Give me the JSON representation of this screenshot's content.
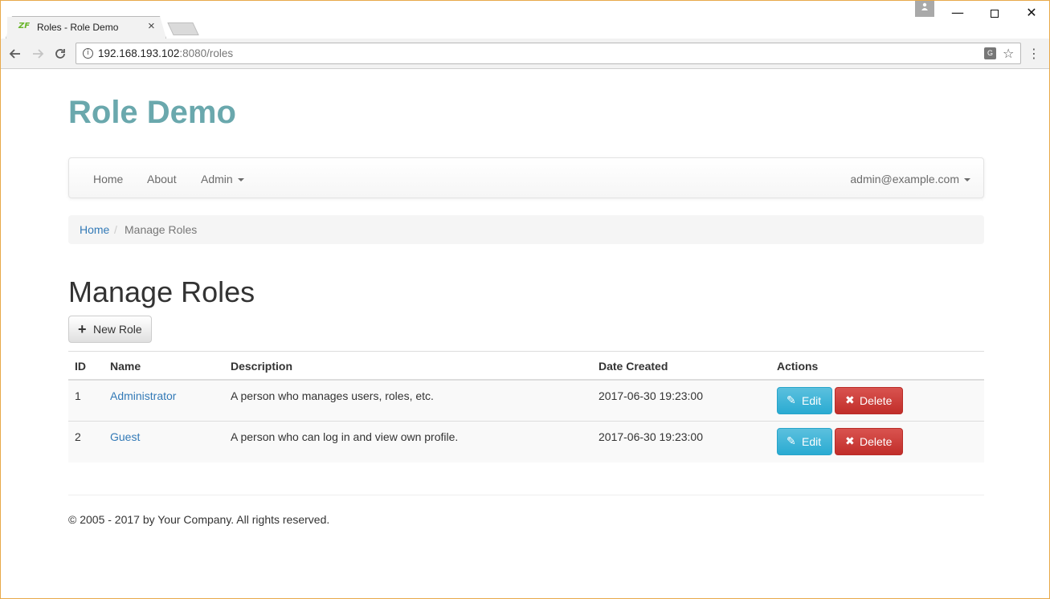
{
  "browser": {
    "tab_title": "Roles - Role Demo",
    "tab_favicon": "ZF",
    "tab_close": "×",
    "url_host": "192.168.193.102",
    "url_rest": ":8080/roles",
    "win_min": "—",
    "win_close": "✕",
    "icons": {
      "back": "arrow-left-icon",
      "forward": "arrow-right-icon",
      "reload": "reload-icon",
      "info": "info-icon",
      "translate": "translate-icon",
      "star": "star-icon",
      "menu": "kebab-menu-icon",
      "profile": "person-icon"
    }
  },
  "site": {
    "title": "Role Demo",
    "title_color": "#6aa8ad"
  },
  "navbar": {
    "home": "Home",
    "about": "About",
    "admin": "Admin",
    "user": "admin@example.com"
  },
  "breadcrumb": {
    "home": "Home",
    "separator": "/",
    "current": "Manage Roles"
  },
  "main": {
    "heading": "Manage Roles",
    "new_role_label": "New Role",
    "table": {
      "headers": {
        "id": "ID",
        "name": "Name",
        "description": "Description",
        "date_created": "Date Created",
        "actions": "Actions"
      },
      "rows": [
        {
          "id": "1",
          "name": "Administrator",
          "description": "A person who manages users, roles, etc.",
          "date_created": "2017-06-30 19:23:00",
          "edit_label": "Edit",
          "delete_label": "Delete"
        },
        {
          "id": "2",
          "name": "Guest",
          "description": "A person who can log in and view own profile.",
          "date_created": "2017-06-30 19:23:00",
          "edit_label": "Edit",
          "delete_label": "Delete"
        }
      ]
    }
  },
  "footer": {
    "text": "© 2005 - 2017 by Your Company. All rights reserved."
  },
  "colors": {
    "link": "#337ab7",
    "edit": "#5bc0de",
    "delete": "#d9534f"
  }
}
